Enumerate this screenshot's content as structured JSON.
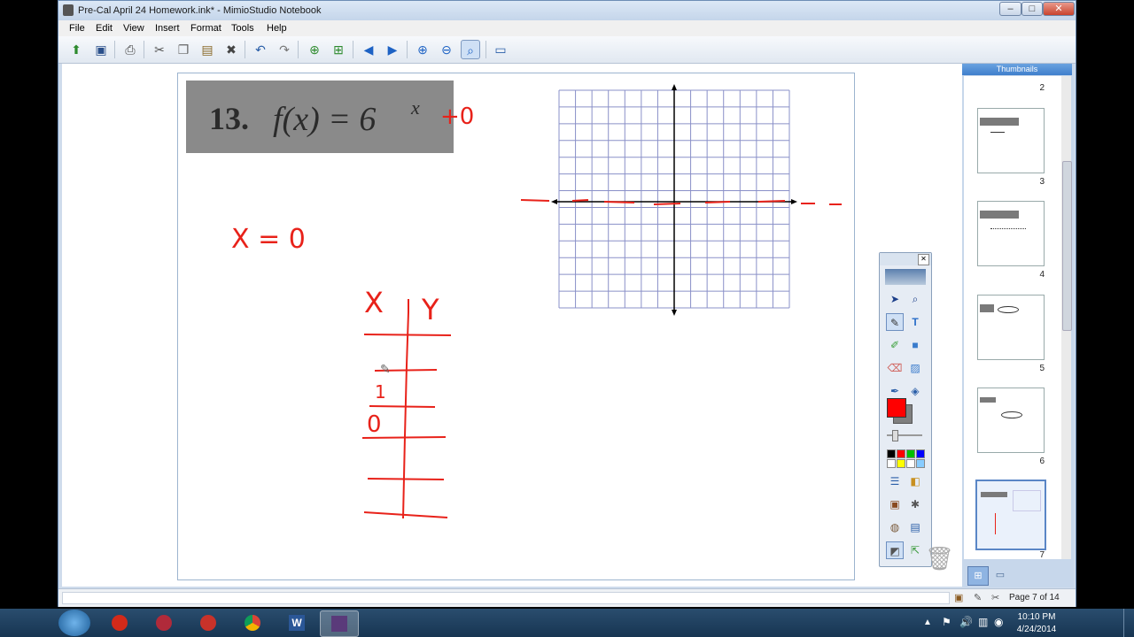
{
  "window": {
    "title": "Pre-Cal April 24 Homework.ink* - MimioStudio Notebook",
    "controls": [
      "–",
      "□",
      "✕"
    ]
  },
  "menu": [
    "File",
    "Edit",
    "View",
    "Insert",
    "Format",
    "Tools",
    "Help"
  ],
  "toolbar": {
    "buttons": [
      {
        "name": "open-icon",
        "glyph": "📂"
      },
      {
        "name": "save-icon",
        "glyph": "💾"
      },
      {
        "name": "print-icon",
        "glyph": "🖨"
      },
      {
        "name": "cut-icon",
        "glyph": "✂"
      },
      {
        "name": "copy-icon",
        "glyph": "❐"
      },
      {
        "name": "paste-icon",
        "glyph": "📋"
      },
      {
        "name": "delete-icon",
        "glyph": "✖"
      },
      {
        "name": "undo-icon",
        "glyph": "↶"
      },
      {
        "name": "redo-icon",
        "glyph": "↷"
      },
      {
        "name": "new-page-icon",
        "glyph": "⊕"
      },
      {
        "name": "duplicate-page-icon",
        "glyph": "⊞"
      },
      {
        "name": "previous-page-icon",
        "glyph": "◀"
      },
      {
        "name": "next-page-icon",
        "glyph": "▶"
      },
      {
        "name": "zoom-in-icon",
        "glyph": "🔍"
      },
      {
        "name": "zoom-out-icon",
        "glyph": "🔎"
      },
      {
        "name": "zoom-fit-icon",
        "glyph": "⌕"
      },
      {
        "name": "display-icon",
        "glyph": "▭"
      }
    ]
  },
  "problem": {
    "number": "13.",
    "function": "f(x) = 6",
    "exponent": "x",
    "handwritten_suffix": "+0"
  },
  "handwriting": {
    "x_equals": "X = 0",
    "table_x_header": "X",
    "table_y_header": "Y",
    "row_values": [
      "1",
      "0"
    ]
  },
  "thumbnails": {
    "header": "Thumbnails",
    "pages": [
      "2",
      "3",
      "4",
      "5",
      "6",
      "7"
    ]
  },
  "status": {
    "page_label": "Page 7 of 14"
  },
  "taskbar": {
    "time": "10:10 PM",
    "date": "4/24/2014"
  },
  "palette_colors": [
    "#000000",
    "#ff0000",
    "#00c000",
    "#0000ff",
    "#ffffff",
    "#ffff00",
    "#ffffff",
    "#88ccff"
  ]
}
